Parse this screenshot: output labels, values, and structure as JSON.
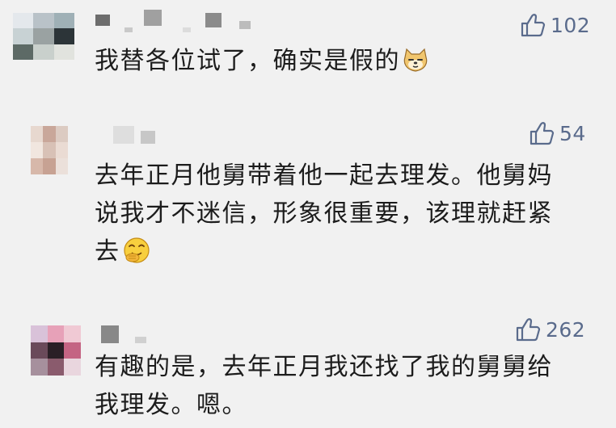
{
  "comments": [
    {
      "likes": "102",
      "text": "我替各位试了，确实是假的",
      "emoji": "doge-emoji",
      "avatar_colors": [
        "#e4e8ec",
        "#b9c2c8",
        "#9fb0b6",
        "#c8d2d4",
        "#9aa2a2",
        "#2c3438",
        "#5d6a66",
        "#c9d0cc",
        "#e1e3de"
      ],
      "name_colors": [
        "#6d6d6d",
        "#c9c9c9",
        "#a0a0a0",
        "#dcdcdc",
        "#8b8b8b",
        "#bcbcbc"
      ]
    },
    {
      "likes": "54",
      "text_lines": [
        "去年正月他舅带着他一起去理发。他舅妈",
        "说我才不迷信，形象很重要，该理就赶紧",
        "去"
      ],
      "emoji": "snicker-emoji",
      "avatar_colors": [
        "#e7d8cf",
        "#c9a79a",
        "#dccbc2",
        "#f1e6df",
        "#d8c1b6",
        "#eadbd3",
        "#d7b8aa",
        "#c7a293",
        "#ebe0da"
      ],
      "name_colors": [
        "#dedede",
        "#c7c7c7"
      ]
    },
    {
      "likes": "262",
      "text_lines": [
        "有趣的是，去年正月我还找了我的舅舅给",
        "我理发。嗯。"
      ],
      "avatar_colors": [
        "#d9c2d9",
        "#e7a1b8",
        "#f0c9d4",
        "#6a4a5a",
        "#2a1f26",
        "#c46483",
        "#a6909d",
        "#8a5b6d",
        "#e9d6de"
      ],
      "name_colors": [
        "#888888",
        "#d0d0d0"
      ]
    }
  ],
  "icons": {
    "like": "thumbs-up-icon"
  }
}
